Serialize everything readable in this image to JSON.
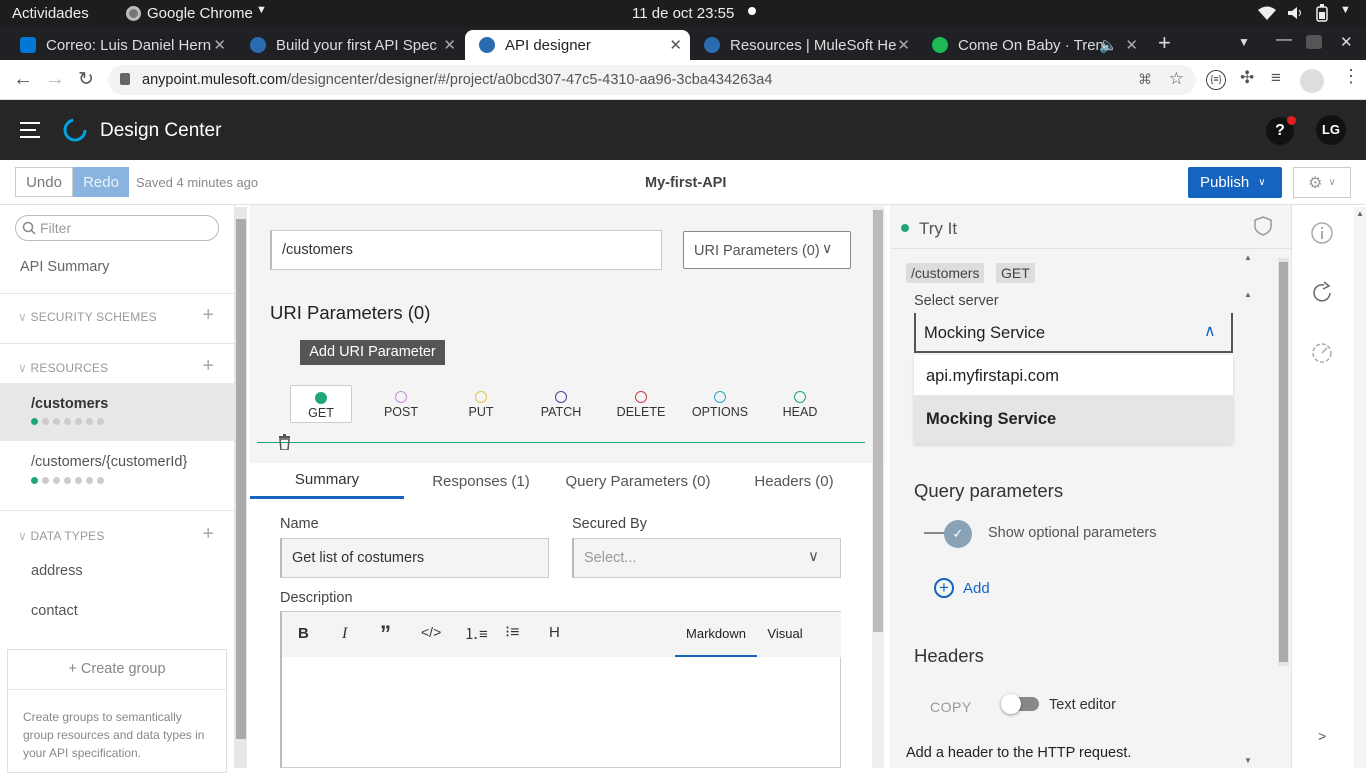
{
  "os": {
    "activities": "Actividades",
    "app": "Google Chrome",
    "datetime": "11 de oct  23:55"
  },
  "browser": {
    "tabs": [
      {
        "title": "Correo: Luis Daniel Hern",
        "color": "#0078d4"
      },
      {
        "title": "Build your first API Spec",
        "color": "#2b6cb0"
      },
      {
        "title": "API designer",
        "color": "#2b6cb0"
      },
      {
        "title": "Resources | MuleSoft He",
        "color": "#2b6cb0"
      },
      {
        "title": "Come On Baby · Tren",
        "color": "#1db954"
      }
    ],
    "url_host": "anypoint.mulesoft.com",
    "url_path": "/designcenter/designer/#/project/a0bcd307-47c5-4310-aa96-3cba434263a4"
  },
  "app": {
    "title": "Design Center",
    "help": "?",
    "avatar": "LG"
  },
  "toolbar": {
    "undo": "Undo",
    "redo": "Redo",
    "saved": "Saved 4 minutes ago",
    "project": "My-first-API",
    "publish": "Publish"
  },
  "sidebar": {
    "filter_placeholder": "Filter",
    "api_summary": "API Summary",
    "security": "SECURITY SCHEMES",
    "resources_title": "RESOURCES",
    "resources": [
      "/customers",
      "/customers/{customerId}"
    ],
    "datatypes_title": "DATA TYPES",
    "datatypes": [
      "address",
      "contact"
    ],
    "create_group": "+ Create group",
    "create_group_help": "Create groups to semantically group resources and data types in your API specification."
  },
  "main": {
    "path": "/customers",
    "uri_dropdown": "URI Parameters (0)",
    "uri_heading": "URI Parameters (0)",
    "add_uri": "Add URI Parameter",
    "methods": [
      {
        "label": "GET",
        "color": "#21a67a"
      },
      {
        "label": "POST",
        "color": "#c98bdc"
      },
      {
        "label": "PUT",
        "color": "#e5c54a"
      },
      {
        "label": "PATCH",
        "color": "#5a3a9a"
      },
      {
        "label": "DELETE",
        "color": "#d43a4a"
      },
      {
        "label": "OPTIONS",
        "color": "#2aa7c9"
      },
      {
        "label": "HEAD",
        "color": "#21a67a"
      }
    ],
    "subtabs": [
      "Summary",
      "Responses (1)",
      "Query Parameters (0)",
      "Headers (0)"
    ],
    "name_label": "Name",
    "name_value": "Get list of costumers",
    "secured_label": "Secured By",
    "secured_placeholder": "Select...",
    "description_label": "Description",
    "editor_tabs": [
      "Markdown",
      "Visual"
    ],
    "editor_tools": [
      "B",
      "I",
      "quote",
      "code",
      "ol",
      "ul",
      "H"
    ]
  },
  "tryit": {
    "title": "Try It",
    "path": "/customers",
    "method": "GET",
    "select_server": "Select server",
    "server_selected": "Mocking Service",
    "server_options": [
      "api.myfirstapi.com",
      "Mocking Service"
    ],
    "query_title": "Query parameters",
    "show_optional": "Show optional parameters",
    "add": "Add",
    "headers_title": "Headers",
    "copy": "COPY",
    "text_editor": "Text editor",
    "add_header_help": "Add a header to the HTTP request."
  }
}
